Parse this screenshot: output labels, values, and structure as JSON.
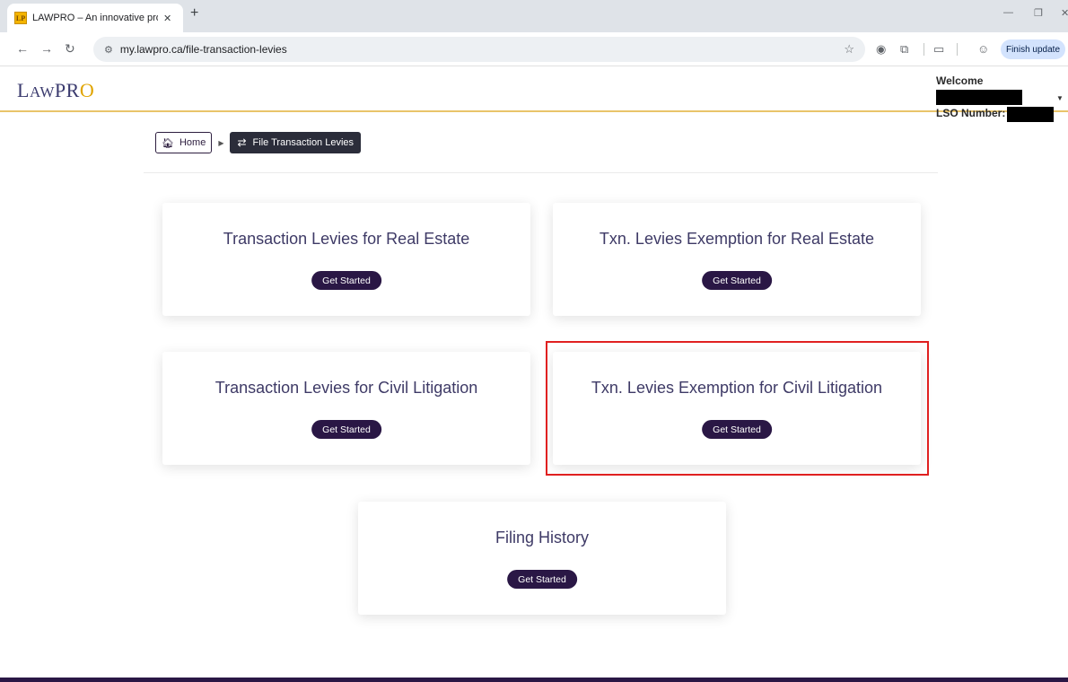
{
  "browser": {
    "tab_title": "LAWPRO – An innovative provic",
    "tab_close": "✕",
    "new_tab": "+",
    "favicon_text": "LP",
    "url": "my.lawpro.ca/file-transaction-levies",
    "finish_update": "Finish update",
    "icons": [
      "back-icon",
      "forward-icon",
      "reload-icon",
      "site-info-icon",
      "star-icon",
      "google-lens-icon",
      "extensions-icon",
      "reading-mode-icon",
      "profile-icon"
    ]
  },
  "header": {
    "logo_first": "L",
    "logo_small": "AW",
    "logo_pr": "PR",
    "logo_o": "O",
    "welcome_label": "Welcome",
    "lso_label": "LSO Number:"
  },
  "breadcrumb": {
    "home": "Home",
    "current": "File Transaction Levies"
  },
  "cards": [
    {
      "title": "Transaction Levies for Real Estate",
      "button": "Get Started"
    },
    {
      "title": "Txn. Levies Exemption for Real Estate",
      "button": "Get Started"
    },
    {
      "title": "Transaction Levies for Civil Litigation",
      "button": "Get Started"
    },
    {
      "title": "Txn. Levies Exemption for Civil Litigation",
      "button": "Get Started",
      "highlighted": true
    },
    {
      "title": "Filing History",
      "button": "Get Started"
    }
  ],
  "colors": {
    "brand_dark": "#2a1745",
    "title_text": "#3e3a66",
    "accent_gold": "#e9c46a",
    "highlight_red": "#e02020"
  }
}
